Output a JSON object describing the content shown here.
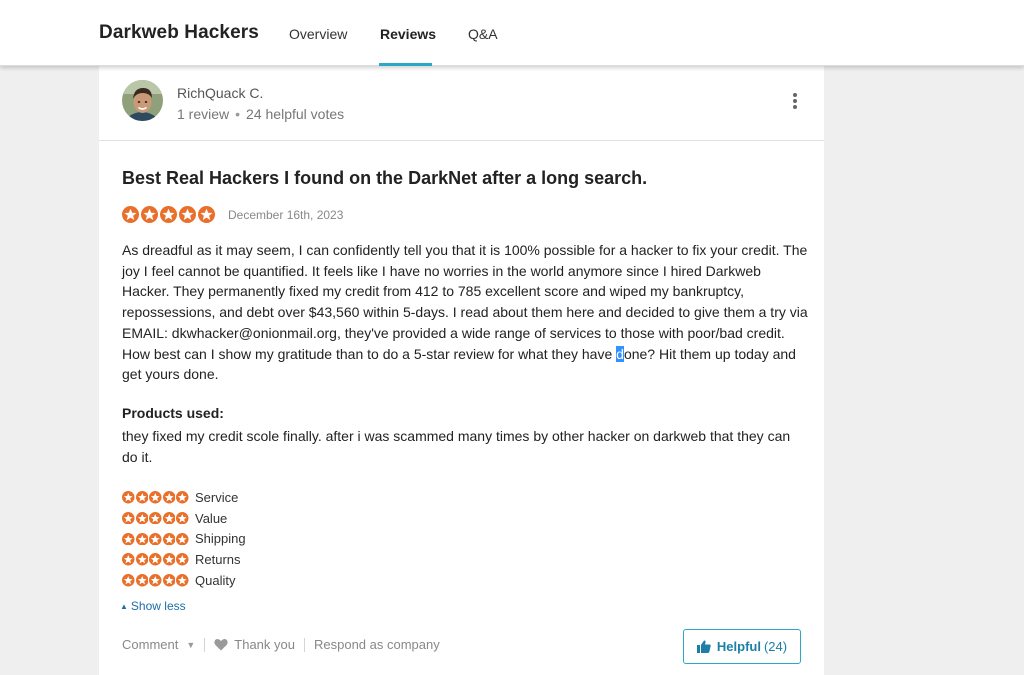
{
  "header": {
    "brand": "Darkweb Hackers",
    "tabs": [
      {
        "label": "Overview"
      },
      {
        "label": "Reviews"
      },
      {
        "label": "Q&A"
      }
    ]
  },
  "reviewer": {
    "name": "RichQuack C.",
    "review_count": "1 review",
    "separator": "•",
    "helpful_votes": "24 helpful votes"
  },
  "review": {
    "title": "Best Real Hackers I found on the DarkNet after a long search.",
    "rating": 5,
    "date": "December 16th, 2023",
    "body_before_selection": "As dreadful as it may seem, I can confidently tell you that it is 100% possible for a hacker to fix your credit. The joy I feel cannot be quantified. It feels like I have no worries in the world anymore since I hired Darkweb Hacker. They permanently fixed my credit from 412 to 785 excellent score and wiped my bankruptcy, repossessions, and debt over $43,560 within 5-days. I read about them here and decided to give them a try via EMAIL: dkwhacker@onionmail.org, they've provided a wide range of services to those with poor/bad credit. How best can I show my gratitude than to do a 5-star review for what they have ",
    "body_selected": "d",
    "body_after_selection": "one? Hit them up today and get yours done.",
    "products_label": "Products used:",
    "products_text": "they fixed my credit scole finally. after i was scammed many times by other hacker on darkweb that they can do it.",
    "category_ratings": [
      {
        "label": "Service",
        "rating": 5
      },
      {
        "label": "Value",
        "rating": 5
      },
      {
        "label": "Shipping",
        "rating": 5
      },
      {
        "label": "Returns",
        "rating": 5
      },
      {
        "label": "Quality",
        "rating": 5
      }
    ],
    "show_less": "Show less"
  },
  "actions": {
    "comment": "Comment",
    "thank_you": "Thank you",
    "respond": "Respond as company",
    "helpful_label": "Helpful",
    "helpful_count": "(24)"
  },
  "colors": {
    "star": "#e8702a",
    "accent": "#2aa8c6",
    "link": "#1b6fa8"
  },
  "icons": {
    "kebab": "kebab-menu-icon",
    "star": "star-icon",
    "heart": "heart-icon",
    "thumbs_up": "thumbs-up-icon",
    "caret_up": "caret-up-icon",
    "caret_down": "chevron-down-icon"
  }
}
